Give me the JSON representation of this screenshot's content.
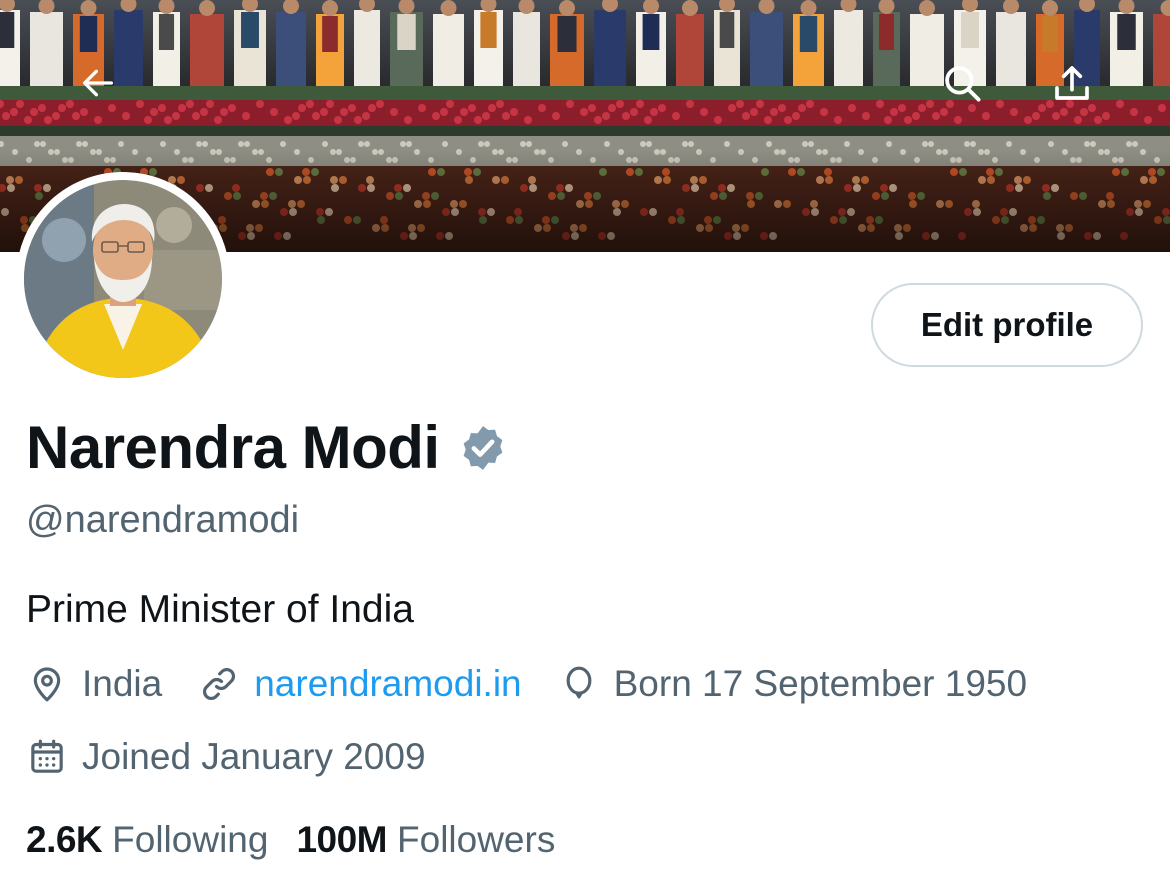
{
  "colors": {
    "text_primary": "#0f1419",
    "text_secondary": "#536471",
    "link": "#1d9bf0",
    "border": "#cfd9de",
    "verified_badge": "#829aab"
  },
  "header": {
    "back_icon": "arrow-left-icon",
    "search_icon": "search-icon",
    "share_icon": "share-upload-icon"
  },
  "profile": {
    "avatar_icon": "avatar-photo",
    "edit_button_label": "Edit profile",
    "display_name": "Narendra Modi",
    "verified_icon": "verified-badge-icon",
    "handle": "@narendramodi",
    "bio": "Prime Minister of India",
    "location": "India",
    "website": "narendramodi.in",
    "birthday": "Born 17 September 1950",
    "joined": "Joined January 2009"
  },
  "stats": {
    "following_count": "2.6K",
    "following_label": "Following",
    "followers_count": "100M",
    "followers_label": "Followers"
  }
}
